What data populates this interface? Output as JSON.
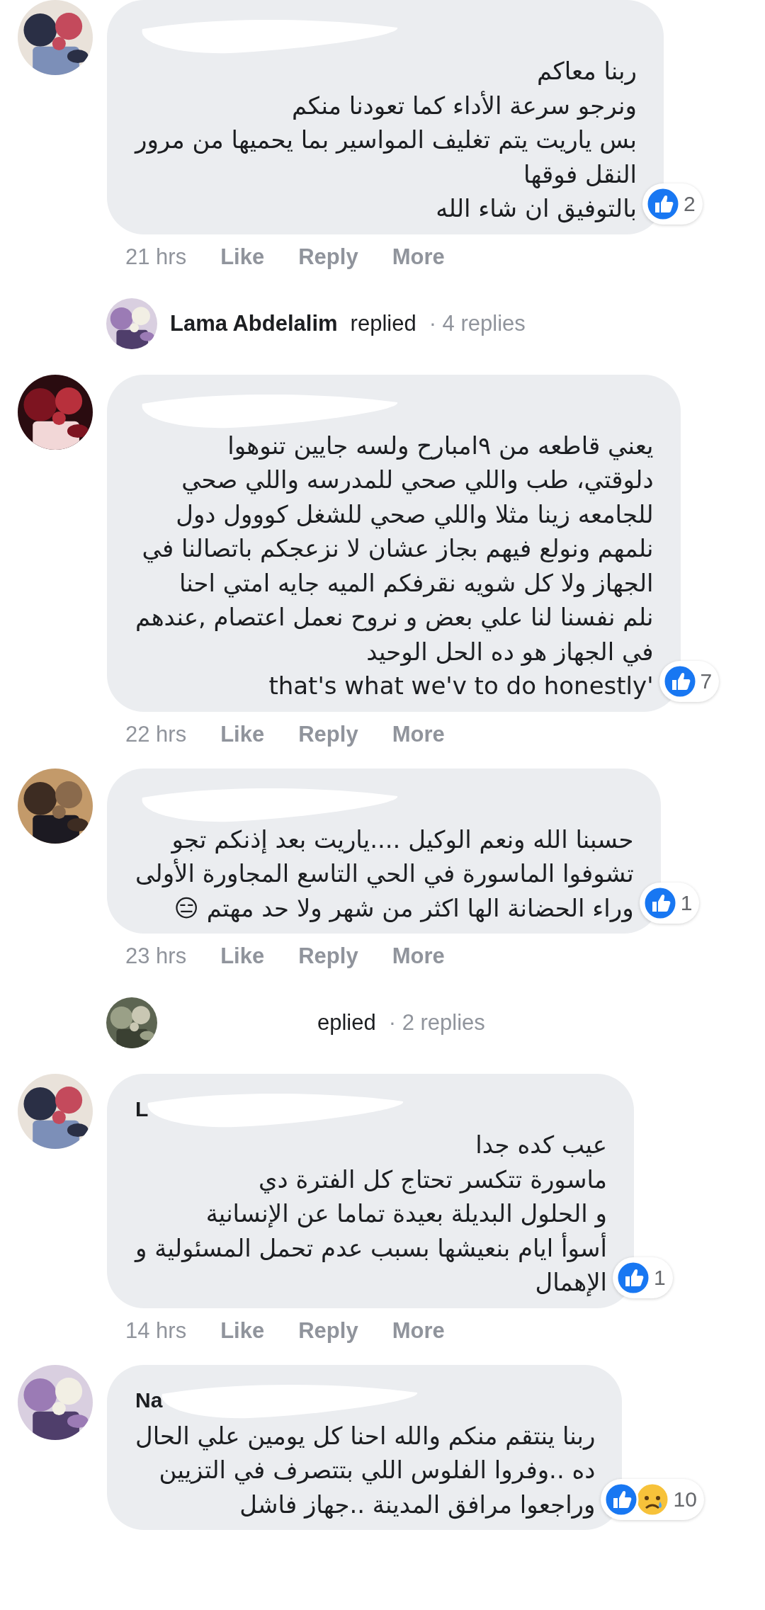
{
  "items": [
    {
      "kind": "comment",
      "redacted_name": true,
      "text": "ربنا معاكم\nونرجو سرعة الأداء كما تعودنا منكم\nبس ياريت يتم تغليف المواسير بما يحميها من مرور\nالنقل فوقها\nبالتوفيق ان شاء الله",
      "reactions": [
        {
          "kind": "like"
        }
      ],
      "reaction_count": "2",
      "time": "21 hrs",
      "like_label": "Like",
      "reply_label": "Reply",
      "more_label": "More"
    },
    {
      "kind": "replies",
      "author": "Lama Abdelalim",
      "verb": "replied",
      "count": "· 4 replies"
    },
    {
      "kind": "comment",
      "redacted_name": true,
      "text": "يعني قاطعه من ٩امبارح ولسه جايين تنوهوا\nدلوقتي، طب واللي صحي للمدرسه واللي صحي\nللجامعه زينا مثلا واللي صحي للشغل كووول دول\nنلمهم ونولع فيهم بجاز عشان لا نزعجكم باتصالنا في\nالجهاز ولا كل شويه نقرفكم الميه جايه امتي احنا\nنلم نفسنا لنا علي بعض و نروح نعمل اعتصام ,عندهم\nفي الجهاز هو ده الحل الوحيد\nthat's what we'v to do honestly'",
      "reactions": [
        {
          "kind": "like"
        }
      ],
      "reaction_count": "7",
      "time": "22 hrs",
      "like_label": "Like",
      "reply_label": "Reply",
      "more_label": "More"
    },
    {
      "kind": "comment",
      "redacted_name": true,
      "text": "حسبنا الله ونعم الوكيل ....ياريت بعد إذنكم تجو\nتشوفوا الماسورة في الحي التاسع المجاورة الأولى\nوراء الحضانة الها اكثر من شهر ولا حد مهتم 😑",
      "reactions": [
        {
          "kind": "like"
        }
      ],
      "reaction_count": "1",
      "time": "23 hrs",
      "like_label": "Like",
      "reply_label": "Reply",
      "more_label": "More"
    },
    {
      "kind": "replies",
      "verb": "eplied",
      "count": "· 2 replies"
    },
    {
      "kind": "comment",
      "author": "L",
      "redacted_name": true,
      "text": "عيب كده جدا\nماسورة تتكسر تحتاج كل الفترة دي\nو الحلول البديلة بعيدة تماما عن الإنسانية\nأسوأ ايام بنعيشها بسبب عدم تحمل المسئولية و\nالإهمال",
      "reactions": [
        {
          "kind": "like"
        }
      ],
      "reaction_count": "1",
      "time": "14 hrs",
      "like_label": "Like",
      "reply_label": "Reply",
      "more_label": "More"
    },
    {
      "kind": "comment",
      "author": "Na",
      "redacted_name": true,
      "text": "ربنا ينتقم منكم والله احنا كل يومين علي الحال\nده ..وفروا الفلوس اللي بتتصرف في التزيين\nوراجعوا مرافق المدينة ..جهاز فاشل",
      "reactions": [
        {
          "kind": "like"
        },
        {
          "kind": "sad"
        }
      ],
      "reaction_count": "10"
    }
  ]
}
